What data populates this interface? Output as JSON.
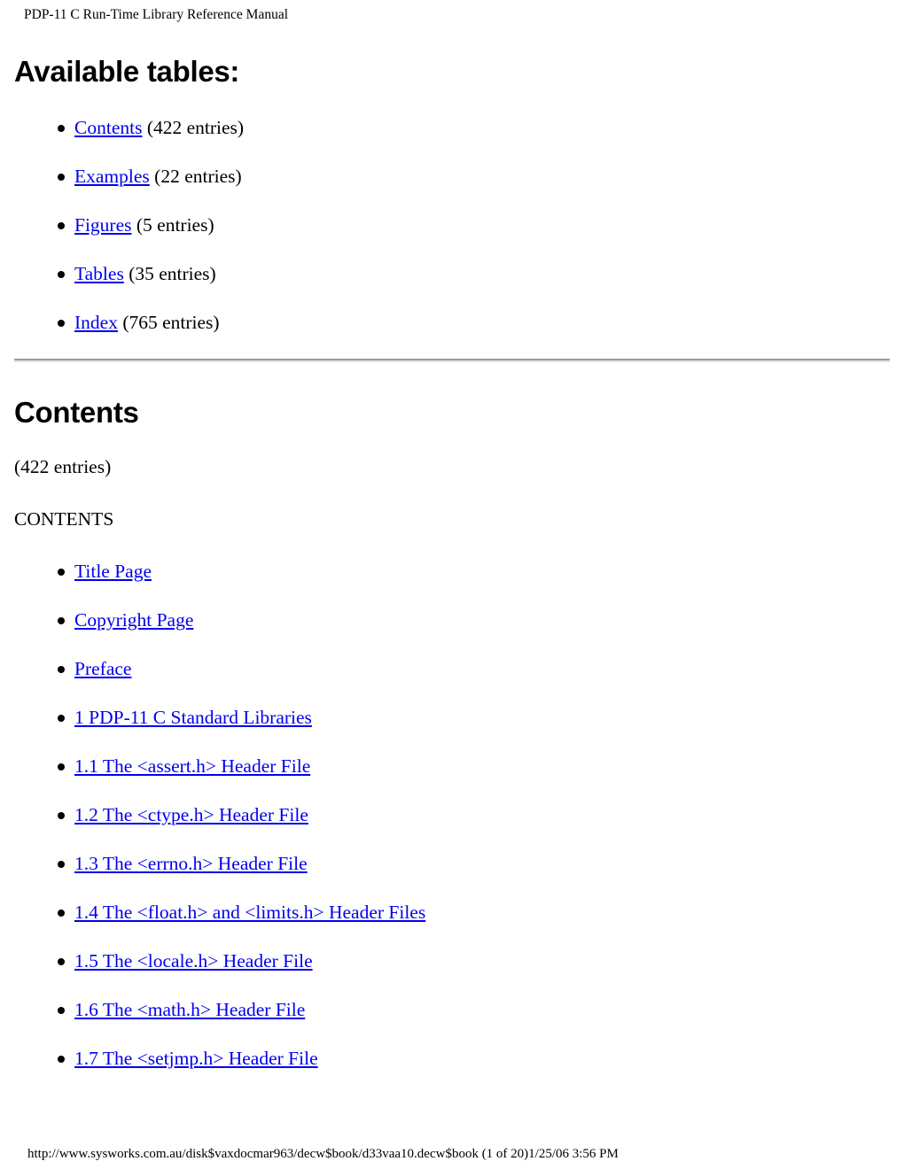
{
  "header": {
    "running_title": "PDP-11 C Run-Time Library Reference Manual"
  },
  "available_tables": {
    "heading": "Available tables:",
    "items": [
      {
        "link": "Contents",
        "count": "(422 entries)"
      },
      {
        "link": "Examples",
        "count": "(22 entries)"
      },
      {
        "link": "Figures",
        "count": "(5 entries)"
      },
      {
        "link": "Tables",
        "count": "(35 entries)"
      },
      {
        "link": "Index",
        "count": "(765 entries)"
      }
    ]
  },
  "contents_section": {
    "heading": "Contents",
    "entry_count": "(422 entries)",
    "label": "CONTENTS",
    "items": [
      {
        "link": "Title Page"
      },
      {
        "link": "Copyright Page"
      },
      {
        "link": "Preface"
      },
      {
        "link": "1 PDP-11 C Standard Libraries"
      },
      {
        "link": "1.1 The <assert.h> Header File"
      },
      {
        "link": "1.2 The <ctype.h> Header File"
      },
      {
        "link": "1.3 The <errno.h> Header File"
      },
      {
        "link": "1.4 The <float.h> and <limits.h> Header Files"
      },
      {
        "link": "1.5 The <locale.h> Header File"
      },
      {
        "link": "1.6 The <math.h> Header File"
      },
      {
        "link": "1.7 The <setjmp.h> Header File"
      }
    ]
  },
  "footer": {
    "url_line": "http://www.sysworks.com.au/disk$vaxdocmar963/decw$book/d33vaa10.decw$book (1 of 20)1/25/06 3:56 PM"
  },
  "colors": {
    "link": "#0000ee",
    "text": "#000000",
    "background": "#ffffff",
    "rule_dark": "#9a9a9a",
    "rule_light": "#e2e2e2"
  }
}
